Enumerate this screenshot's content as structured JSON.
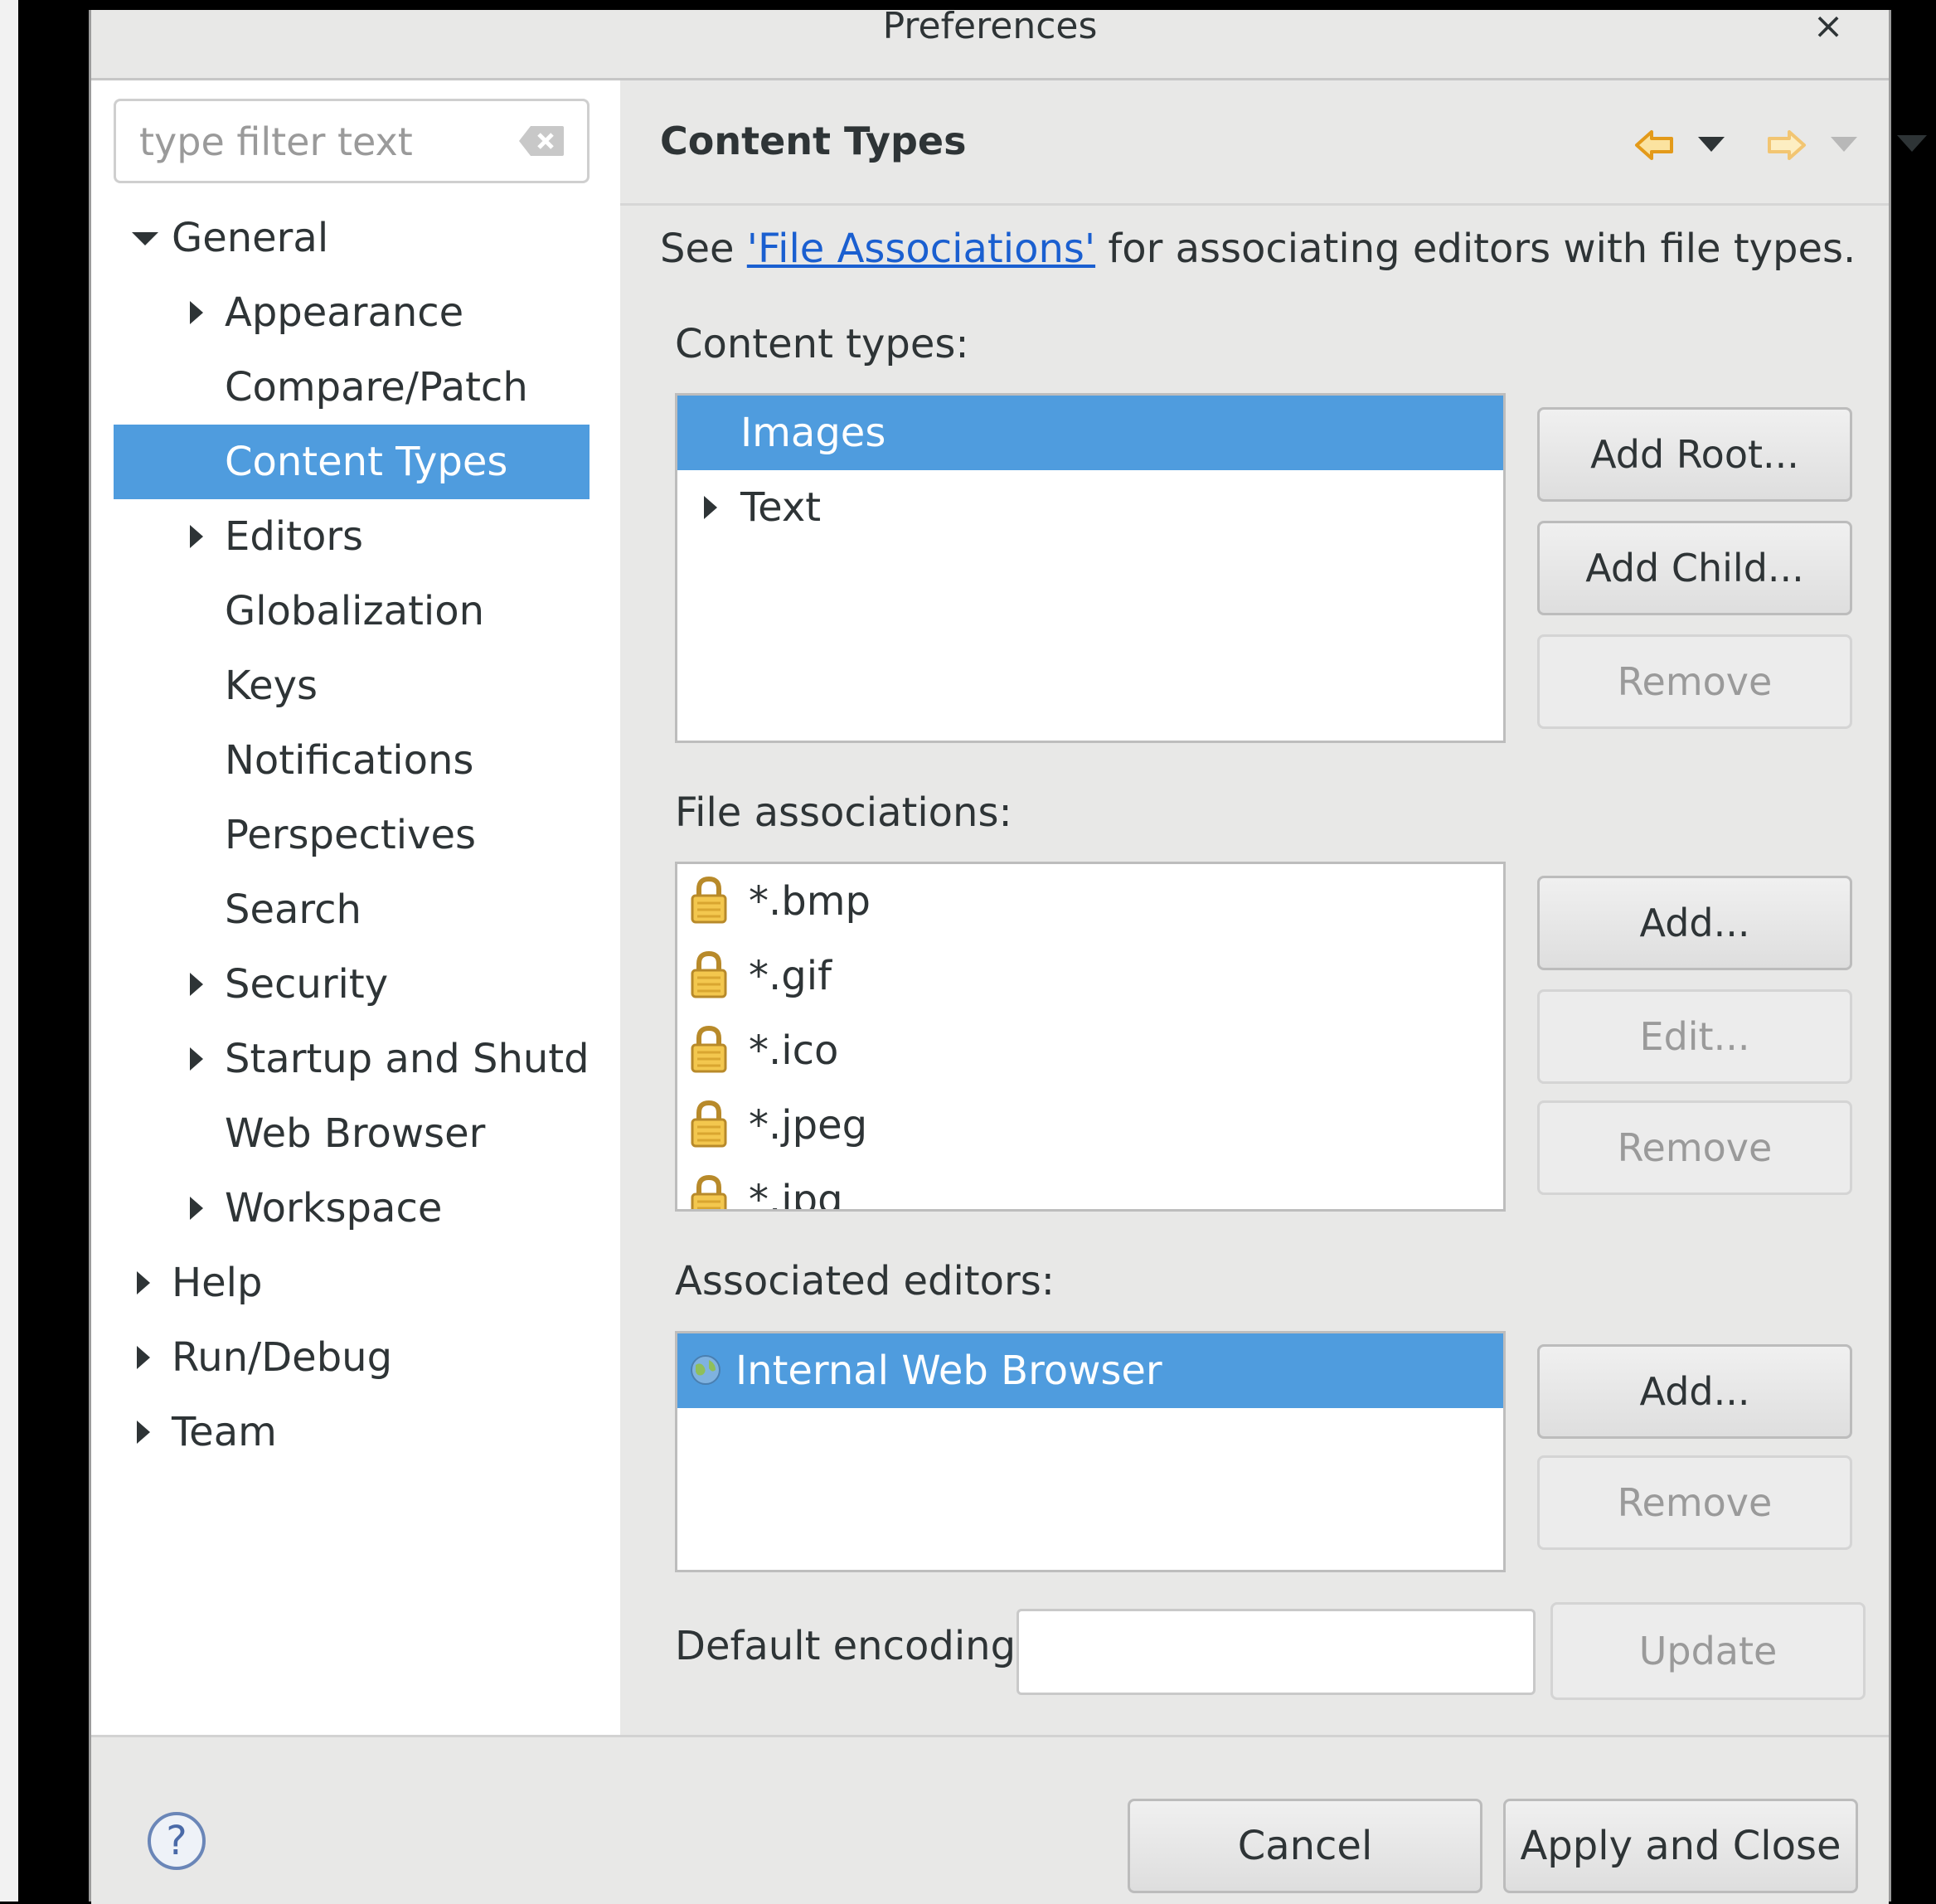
{
  "window": {
    "title": "Preferences",
    "close_label": "×"
  },
  "filter": {
    "placeholder": "type filter text"
  },
  "tree": [
    {
      "label": "General",
      "expander": "down",
      "level": 0
    },
    {
      "label": "Appearance",
      "expander": "right",
      "level": 1
    },
    {
      "label": "Compare/Patch",
      "expander": "none",
      "level": 1
    },
    {
      "label": "Content Types",
      "expander": "none",
      "level": 1,
      "selected": true
    },
    {
      "label": "Editors",
      "expander": "right",
      "level": 1
    },
    {
      "label": "Globalization",
      "expander": "none",
      "level": 1
    },
    {
      "label": "Keys",
      "expander": "none",
      "level": 1
    },
    {
      "label": "Notifications",
      "expander": "none",
      "level": 1
    },
    {
      "label": "Perspectives",
      "expander": "none",
      "level": 1
    },
    {
      "label": "Search",
      "expander": "none",
      "level": 1
    },
    {
      "label": "Security",
      "expander": "right",
      "level": 1
    },
    {
      "label": "Startup and Shutdo",
      "expander": "right",
      "level": 1
    },
    {
      "label": "Web Browser",
      "expander": "none",
      "level": 1
    },
    {
      "label": "Workspace",
      "expander": "right",
      "level": 1
    },
    {
      "label": "Help",
      "expander": "right",
      "level": 0
    },
    {
      "label": "Run/Debug",
      "expander": "right",
      "level": 0
    },
    {
      "label": "Team",
      "expander": "right",
      "level": 0
    }
  ],
  "page": {
    "title": "Content Types",
    "hint_prefix": "See ",
    "hint_link": "'File Associations'",
    "hint_suffix": " for associating editors with file types."
  },
  "content_types": {
    "label": "Content types:",
    "items": [
      {
        "label": "Images",
        "selected": true,
        "expander": "none"
      },
      {
        "label": "Text",
        "selected": false,
        "expander": "right"
      }
    ],
    "buttons": {
      "add_root": "Add Root...",
      "add_child": "Add Child...",
      "remove": "Remove"
    }
  },
  "file_associations": {
    "label": "File associations:",
    "items": [
      "*.bmp",
      "*.gif",
      "*.ico",
      "*.jpeg",
      "*.jpg"
    ],
    "buttons": {
      "add": "Add...",
      "edit": "Edit...",
      "remove": "Remove"
    }
  },
  "associated_editors": {
    "label": "Associated editors:",
    "items": [
      {
        "label": "Internal Web Browser",
        "selected": true,
        "icon": "globe-icon"
      }
    ],
    "buttons": {
      "add": "Add...",
      "remove": "Remove"
    }
  },
  "encoding": {
    "label": "Default encoding:",
    "value": "",
    "update_label": "Update"
  },
  "footer": {
    "help_label": "?",
    "cancel_label": "Cancel",
    "apply_close_label": "Apply and Close"
  },
  "colors": {
    "selection": "#4f9cde",
    "link": "#1a5fd0",
    "nav_arrow": "#f0a030"
  }
}
